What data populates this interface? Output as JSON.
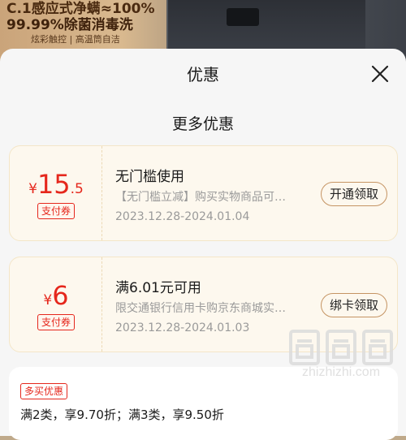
{
  "banner": {
    "line1": "C.1感应式净螨≈100%",
    "line2": "99.99%除菌消毒洗",
    "line3": "炫彩触控 | 高温筒自洁"
  },
  "sheet": {
    "title": "优惠",
    "section_title": "更多优惠"
  },
  "coupons": [
    {
      "currency": "¥",
      "amount_int": "15",
      "amount_dec": ".5",
      "tag": "支付券",
      "title": "无门槛使用",
      "desc": "【无门槛立减】购买实物商品可…",
      "date": "2023.12.28-2024.01.04",
      "button": "开通领取"
    },
    {
      "currency": "¥",
      "amount_int": "6",
      "amount_dec": "",
      "tag": "支付券",
      "title": "满6.01元可用",
      "desc": "限交通银行信用卡购京东商城实…",
      "date": "2023.12.28-2024.01.03",
      "button": "绑卡领取"
    }
  ],
  "promo": {
    "tag": "多买优惠",
    "text": "满2类，享9.70折；满3类，享9.50折"
  },
  "watermark": {
    "url": "zhizhizhi.com"
  },
  "colors": {
    "accent_red": "#e5271c",
    "coupon_bg": "#fdf8ee",
    "button_border": "#c59463"
  }
}
